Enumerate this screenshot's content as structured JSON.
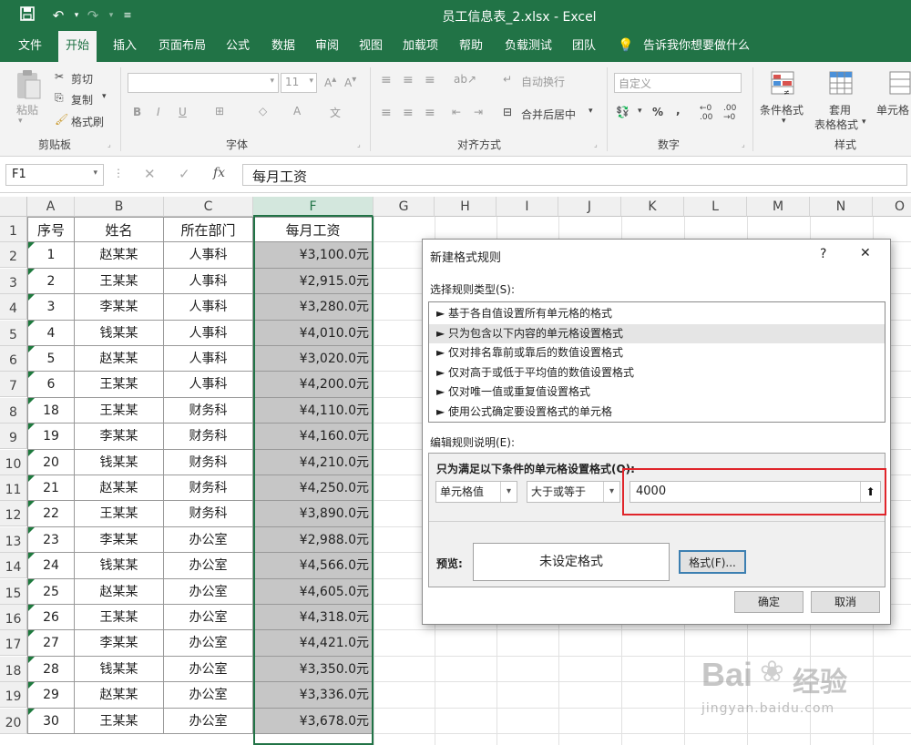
{
  "window": {
    "title": "员工信息表_2.xlsx - Excel"
  },
  "menu_tabs": [
    "文件",
    "开始",
    "插入",
    "页面布局",
    "公式",
    "数据",
    "审阅",
    "视图",
    "加载项",
    "帮助",
    "负载测试",
    "团队"
  ],
  "tell_me": "告诉我你想要做什么",
  "ribbon": {
    "clipboard": {
      "paste": "粘贴",
      "cut": "剪切",
      "copy": "复制",
      "format_painter": "格式刷",
      "label": "剪贴板"
    },
    "font": {
      "size": "11",
      "label": "字体"
    },
    "alignment": {
      "wrap": "自动换行",
      "merge": "合并后居中",
      "label": "对齐方式"
    },
    "number": {
      "format": "自定义",
      "label": "数字"
    },
    "styles": {
      "conditional": "条件格式",
      "table1": "套用",
      "table2": "表格格式",
      "cell_styles": "单元格",
      "label": "样式"
    }
  },
  "formula_bar": {
    "name_box": "F1",
    "fx": "fx",
    "content": "每月工资"
  },
  "columns": [
    "A",
    "B",
    "C",
    "F",
    "G",
    "H",
    "I",
    "J",
    "K",
    "L",
    "M",
    "N",
    "O"
  ],
  "row_numbers": [
    "1",
    "2",
    "3",
    "4",
    "5",
    "6",
    "7",
    "8",
    "9",
    "10",
    "11",
    "12",
    "13",
    "14",
    "15",
    "16",
    "17",
    "18",
    "19",
    "20"
  ],
  "table": {
    "headers": [
      "序号",
      "姓名",
      "所在部门",
      "每月工资"
    ],
    "rows": [
      [
        "1",
        "赵某某",
        "人事科",
        "¥3,100.0元"
      ],
      [
        "2",
        "王某某",
        "人事科",
        "¥2,915.0元"
      ],
      [
        "3",
        "李某某",
        "人事科",
        "¥3,280.0元"
      ],
      [
        "4",
        "钱某某",
        "人事科",
        "¥4,010.0元"
      ],
      [
        "5",
        "赵某某",
        "人事科",
        "¥3,020.0元"
      ],
      [
        "6",
        "王某某",
        "人事科",
        "¥4,200.0元"
      ],
      [
        "18",
        "王某某",
        "财务科",
        "¥4,110.0元"
      ],
      [
        "19",
        "李某某",
        "财务科",
        "¥4,160.0元"
      ],
      [
        "20",
        "钱某某",
        "财务科",
        "¥4,210.0元"
      ],
      [
        "21",
        "赵某某",
        "财务科",
        "¥4,250.0元"
      ],
      [
        "22",
        "王某某",
        "财务科",
        "¥3,890.0元"
      ],
      [
        "23",
        "李某某",
        "办公室",
        "¥2,988.0元"
      ],
      [
        "24",
        "钱某某",
        "办公室",
        "¥4,566.0元"
      ],
      [
        "25",
        "赵某某",
        "办公室",
        "¥4,605.0元"
      ],
      [
        "26",
        "王某某",
        "办公室",
        "¥4,318.0元"
      ],
      [
        "27",
        "李某某",
        "办公室",
        "¥4,421.0元"
      ],
      [
        "28",
        "钱某某",
        "办公室",
        "¥3,350.0元"
      ],
      [
        "29",
        "赵某某",
        "办公室",
        "¥3,336.0元"
      ],
      [
        "30",
        "王某某",
        "办公室",
        "¥3,678.0元"
      ]
    ]
  },
  "dialog": {
    "title": "新建格式规则",
    "help": "?",
    "close": "✕",
    "rule_type_label": "选择规则类型(S):",
    "rule_types": [
      "► 基于各自值设置所有单元格的格式",
      "► 只为包含以下内容的单元格设置格式",
      "► 仅对排名靠前或靠后的数值设置格式",
      "► 仅对高于或低于平均值的数值设置格式",
      "► 仅对唯一值或重复值设置格式",
      "► 使用公式确定要设置格式的单元格"
    ],
    "edit_label": "编辑规则说明(E):",
    "condition_heading": "只为满足以下条件的单元格设置格式(O):",
    "condition_field": "单元格值",
    "condition_operator": "大于或等于",
    "condition_value": "4000",
    "preview_label": "预览:",
    "preview_text": "未设定格式",
    "format_button": "格式(F)...",
    "ok": "确定",
    "cancel": "取消"
  },
  "watermark": {
    "brand": "Bai",
    "brand2": "经验",
    "url": "jingyan.baidu.com"
  },
  "colors": {
    "excel_green": "#217346",
    "highlight_red": "#e0252b",
    "selected_fill": "#c6c6c6"
  }
}
